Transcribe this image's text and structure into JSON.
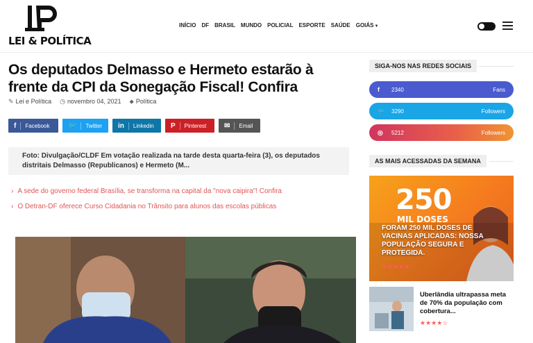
{
  "site": {
    "logo_text": "LEI & POLÍTICA"
  },
  "nav": [
    {
      "label": "INÍCIO"
    },
    {
      "label": "DF"
    },
    {
      "label": "BRASIL"
    },
    {
      "label": "MUNDO"
    },
    {
      "label": "POLICIAL"
    },
    {
      "label": "ESPORTE"
    },
    {
      "label": "SAÚDE"
    },
    {
      "label": "GOIÁS"
    }
  ],
  "article": {
    "title": "Os deputados Delmasso e Hermeto estarão à frente da CPI da Sonegação Fiscal! Confira",
    "author": "Lei e Política",
    "date": "novembro 04, 2021",
    "category": "Política",
    "excerpt": "Foto: Divulgação/CLDF Em votação realizada na tarde desta quarta-feira (3), os deputados distritais Delmasso (Republicanos) e Hermeto (M..."
  },
  "share": [
    {
      "icon": "f",
      "label": "Facebook",
      "color": "#3b5998"
    },
    {
      "icon": "🐦",
      "label": "Twitter",
      "color": "#1da1f2"
    },
    {
      "icon": "in",
      "label": "Linkedin",
      "color": "#0e76a8"
    },
    {
      "icon": "P",
      "label": "Pinterest",
      "color": "#cb2027"
    },
    {
      "icon": "✉",
      "label": "Email",
      "color": "#555555"
    }
  ],
  "related": [
    "A sede do governo federal Brasília, se transforma na capital da \"nova caipira\"! Confira",
    "O Detran-DF oferece Curso Cidadania no Trânsito para alunos das escolas públicas"
  ],
  "sidebar": {
    "social_heading": "SIGA-NOS NAS REDES SOCIAIS",
    "social": [
      {
        "icon": "f",
        "count": "2340",
        "label": "Fans"
      },
      {
        "icon": "🐦",
        "count": "3290",
        "label": "Followers"
      },
      {
        "icon": "◎",
        "count": "5212",
        "label": "Followers"
      }
    ],
    "popular_heading": "AS MAIS ACESSADAS DA SEMANA",
    "feature": {
      "big": "250",
      "sub": "MIL DOSES",
      "caption": "FORAM 250 MIL DOSES DE VACINAS APLICADAS: NOSSA POPULAÇÃO SEGURA E PROTEGIDA.",
      "stars": "★★★★★"
    },
    "mini": {
      "title": "Uberlândia ultrapassa meta de 70% da população com cobertura...",
      "stars": "★★★★☆"
    }
  }
}
